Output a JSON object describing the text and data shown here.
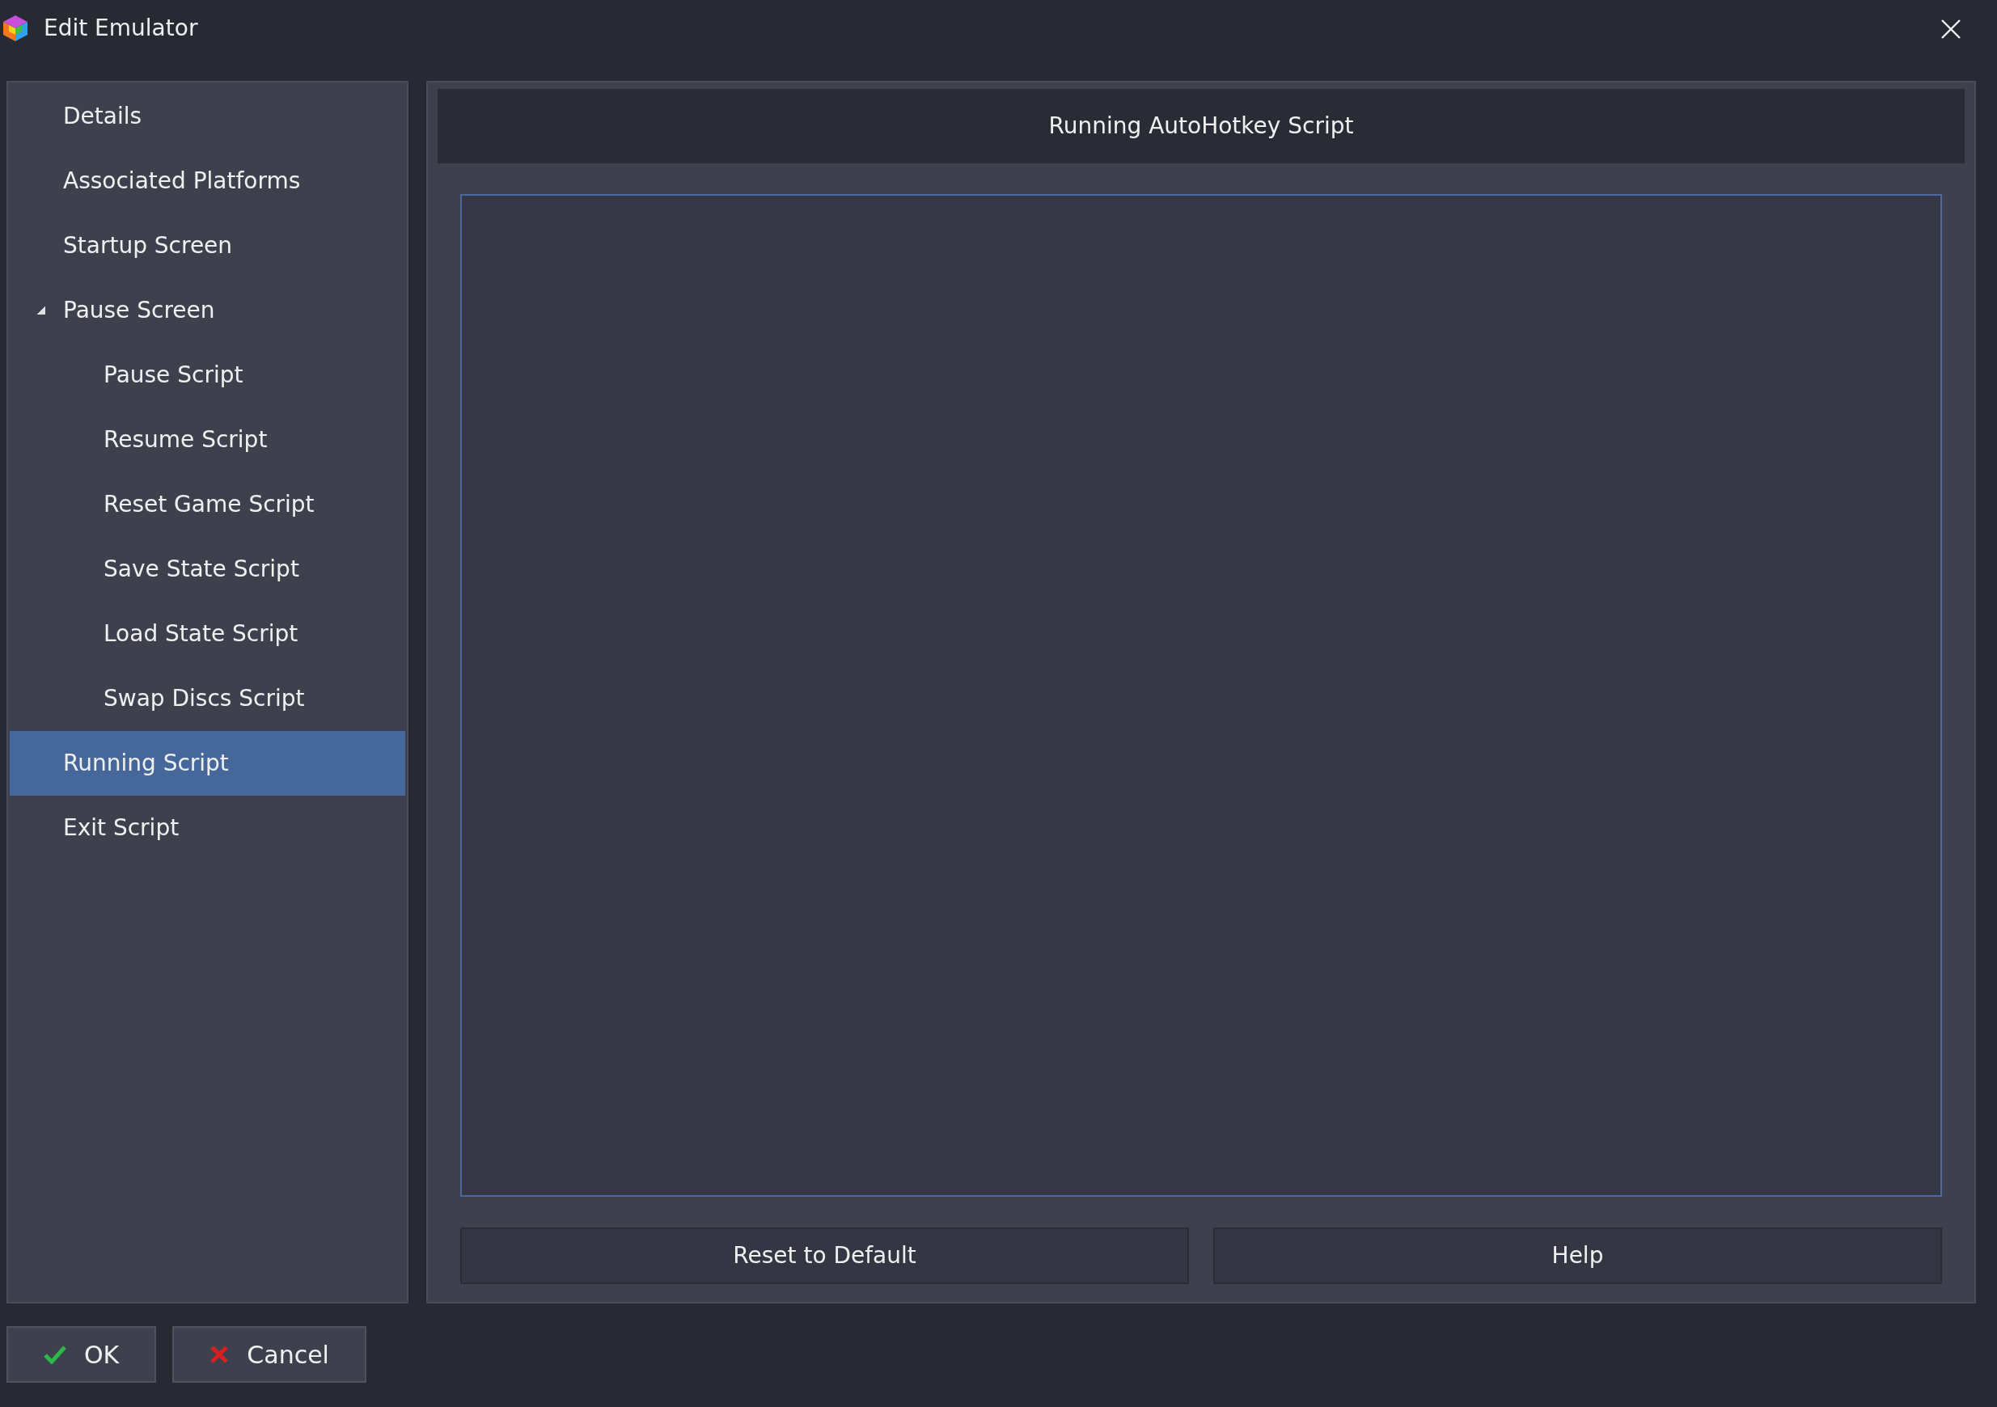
{
  "window": {
    "title": "Edit Emulator"
  },
  "sidebar": {
    "items": [
      {
        "label": "Details",
        "selected": false
      },
      {
        "label": "Associated Platforms",
        "selected": false
      },
      {
        "label": "Startup Screen",
        "selected": false
      },
      {
        "label": "Pause Screen",
        "selected": false,
        "expanded": true,
        "children": [
          {
            "label": "Pause Script",
            "selected": false
          },
          {
            "label": "Resume Script",
            "selected": false
          },
          {
            "label": "Reset Game Script",
            "selected": false
          },
          {
            "label": "Save State Script",
            "selected": false
          },
          {
            "label": "Load State Script",
            "selected": false
          },
          {
            "label": "Swap Discs Script",
            "selected": false
          }
        ]
      },
      {
        "label": "Running Script",
        "selected": true
      },
      {
        "label": "Exit Script",
        "selected": false
      }
    ]
  },
  "panel": {
    "header": "Running AutoHotkey Script",
    "buttons": [
      "Reset to Default",
      "Help"
    ]
  },
  "footer": {
    "buttons": [
      {
        "label": "OK",
        "kind": "ok"
      },
      {
        "label": "Cancel",
        "kind": "cancel"
      }
    ]
  }
}
